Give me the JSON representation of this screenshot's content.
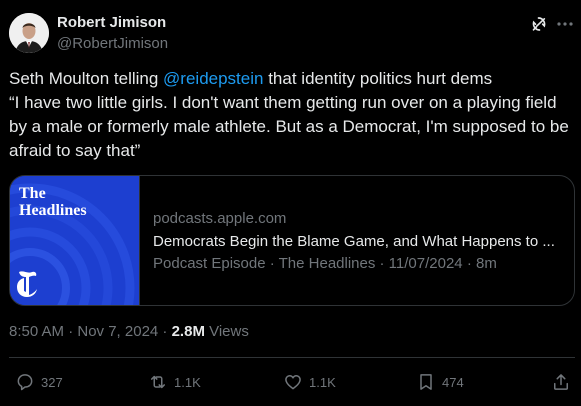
{
  "author": {
    "name": "Robert Jimison",
    "handle": "@RobertJimison"
  },
  "tweet": {
    "text_before": "Seth Moulton telling ",
    "mention": "@reidepstein",
    "text_after": " that identity politics hurt dems\n“I have two little girls. I don't want them getting run over on a playing field by a male or formerly male athlete. But as a Democrat, I'm supposed to be afraid to say that”"
  },
  "card": {
    "thumb_title_line1": "The",
    "thumb_title_line2": "Headlines",
    "domain": "podcasts.apple.com",
    "title": "Democrats Begin the Blame Game, and What Happens to ...",
    "meta": "Podcast Episode · The Headlines · 11/07/2024 · 8m",
    "thumb_color": "#1d3fd0"
  },
  "meta": {
    "timestamp": "8:50 AM · Nov 7, 2024 · ",
    "views_count": "2.8M",
    "views_label": " Views"
  },
  "actions": {
    "replies": "327",
    "reposts": "1.1K",
    "likes": "1.1K",
    "bookmarks": "474"
  },
  "colors": {
    "background": "#000000",
    "text": "#e7e9ea",
    "secondary": "#71767b",
    "link": "#1d9bf0",
    "border": "#2f3336"
  }
}
